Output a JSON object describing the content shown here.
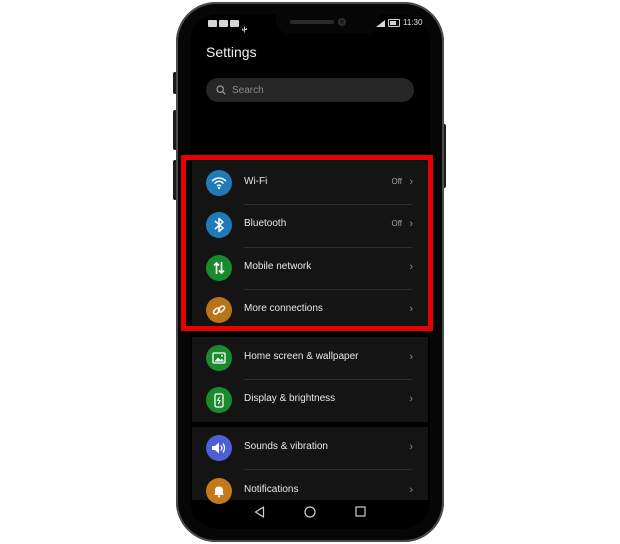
{
  "status_bar": {
    "time": "11:30"
  },
  "header": {
    "title": "Settings"
  },
  "search": {
    "placeholder": "Search"
  },
  "colors": {
    "highlight": "#e60000",
    "wifi": "#1f7bb8",
    "bluetooth": "#1f7bb8",
    "mobile_network": "#1a8a2e",
    "more_connections": "#b8741a",
    "home_screen": "#1a8a2e",
    "display": "#1a8a2e",
    "sounds": "#4a5fd8",
    "notifications": "#c47a1a"
  },
  "connections": [
    {
      "label": "Wi-Fi",
      "value": "Off",
      "icon": "wifi-icon"
    },
    {
      "label": "Bluetooth",
      "value": "Off",
      "icon": "bluetooth-icon"
    },
    {
      "label": "Mobile network",
      "value": "",
      "icon": "mobile-data-icon"
    },
    {
      "label": "More connections",
      "value": "",
      "icon": "link-icon"
    }
  ],
  "display_group": [
    {
      "label": "Home screen & wallpaper",
      "icon": "image-icon"
    },
    {
      "label": "Display & brightness",
      "icon": "phone-brightness-icon"
    }
  ],
  "sound_group": [
    {
      "label": "Sounds & vibration",
      "icon": "speaker-icon"
    },
    {
      "label": "Notifications",
      "icon": "bell-icon"
    }
  ],
  "chevron": "›",
  "navigation": [
    "back-icon",
    "home-icon",
    "recents-icon"
  ]
}
